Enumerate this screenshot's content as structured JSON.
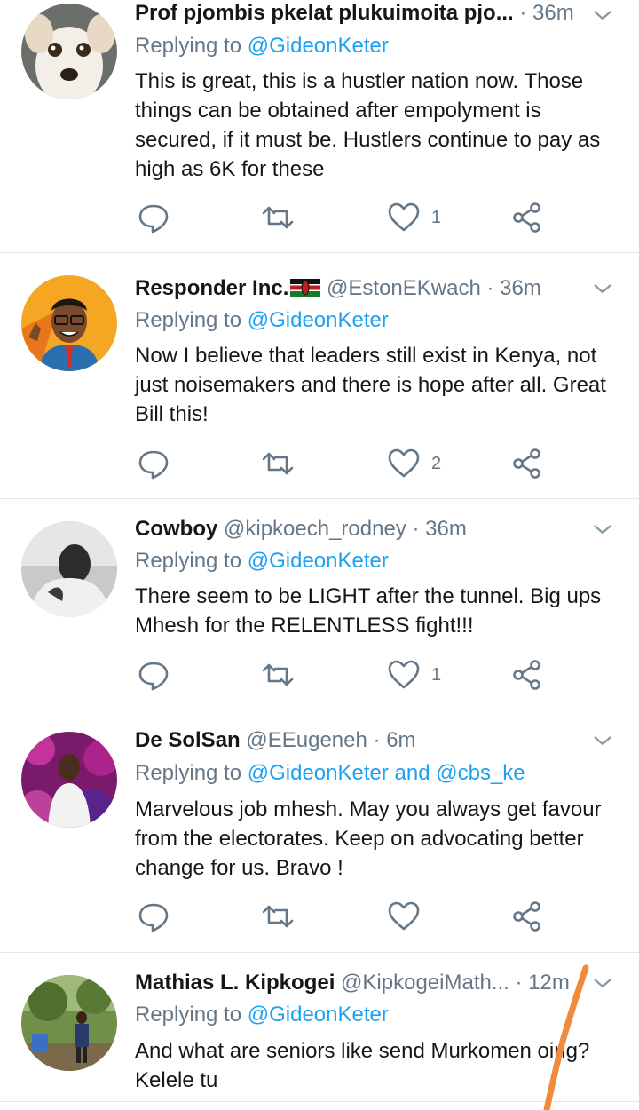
{
  "tweets": [
    {
      "name": "Prof pjombis pkelat plukuimoita pjo...",
      "handle": "",
      "time": "36m",
      "reply_prefix": "Replying to",
      "reply_to": "@GideonKeter",
      "text": "This is great, this is a hustler nation now. Those things can be obtained after empolyment is secured, if it must be. Hustlers continue to pay as high as 6K for these",
      "likes": "1",
      "avatar": "dog-avatar"
    },
    {
      "name": "Responder Inc.",
      "handle": "@EstonEKwach",
      "time": "36m",
      "reply_prefix": "Replying to",
      "reply_to": "@GideonKeter",
      "text": "Now I believe that leaders still exist in Kenya, not just noisemakers and there is hope after all. Great Bill this!",
      "likes": "2",
      "avatar": "cartoon-man-avatar"
    },
    {
      "name": "Cowboy",
      "handle": "@kipkoech_rodney",
      "time": "36m",
      "reply_prefix": "Replying to",
      "reply_to": "@GideonKeter",
      "text": "There seem to be LIGHT after the tunnel. Big ups Mhesh for the RELENTLESS fight!!!",
      "likes": "1",
      "avatar": "grayscale-photo-avatar"
    },
    {
      "name": "De SolSan",
      "handle": "@EEugeneh",
      "time": "6m",
      "reply_prefix": "Replying to",
      "reply_to": "@GideonKeter and @cbs_ke",
      "text": "Marvelous job mhesh. May you always get favour from the electorates. Keep on advocating better change for us. Bravo !",
      "likes": "",
      "avatar": "pink-background-photo-avatar"
    },
    {
      "name": "Mathias L. Kipkogei",
      "handle": "@KipkogeiMath...",
      "time": "12m",
      "reply_prefix": "Replying to",
      "reply_to": "@GideonKeter",
      "text": "And what are seniors like send Murkomen  oing? Kelele tu",
      "likes": "",
      "avatar": "outdoor-photo-avatar"
    }
  ],
  "colors": {
    "text": "#14171a",
    "muted": "#657786",
    "link": "#1da1f2",
    "divider": "#e1e8ed",
    "annotation": "#f08a3c"
  }
}
